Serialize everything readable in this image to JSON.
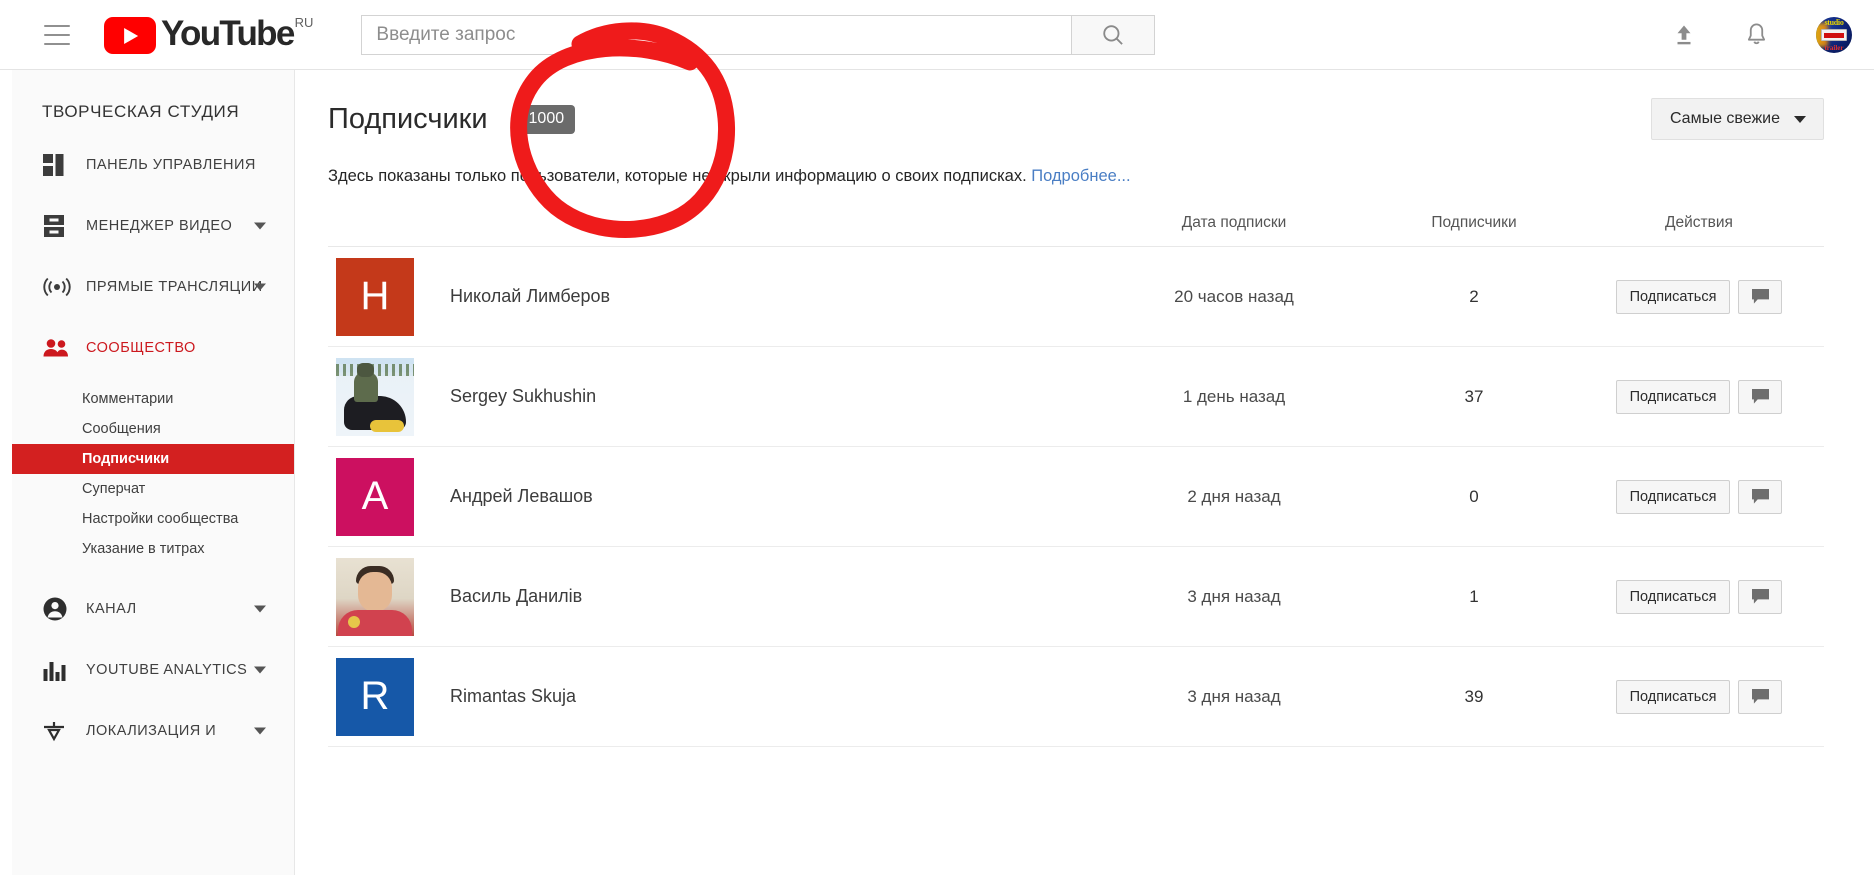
{
  "masthead": {
    "menu_icon": "hamburger-icon",
    "logo_text": "YouTube",
    "logo_country": "RU",
    "search_placeholder": "Введите запрос",
    "search_value": "",
    "search_icon": "search-icon",
    "upload_icon": "upload-icon",
    "notifications_icon": "bell-icon",
    "avatar_icon": "account-avatar",
    "avatar_top_text": "studio",
    "avatar_bottom_text": "trailer"
  },
  "sidebar": {
    "title": "ТВОРЧЕСКАЯ СТУДИЯ",
    "items": [
      {
        "label": "ПАНЕЛЬ УПРАВЛЕНИЯ",
        "icon": "dashboard-icon",
        "expandable": false,
        "active": false
      },
      {
        "label": "МЕНЕДЖЕР ВИДЕО",
        "icon": "video-manager-icon",
        "expandable": true,
        "active": false
      },
      {
        "label": "ПРЯМЫЕ ТРАНСЛЯЦИИ",
        "icon": "live-broadcast-icon",
        "expandable": true,
        "active": false
      },
      {
        "label": "СООБЩЕСТВО",
        "icon": "community-people-icon",
        "expandable": false,
        "active": true
      },
      {
        "label": "КАНАЛ",
        "icon": "channel-person-icon",
        "expandable": true,
        "active": false
      },
      {
        "label": "YOUTUBE ANALYTICS",
        "icon": "analytics-bars-icon",
        "expandable": true,
        "active": false
      },
      {
        "label": "ЛОКАЛИЗАЦИЯ И",
        "icon": "translate-icon",
        "expandable": true,
        "active": false
      }
    ],
    "sub_items": [
      {
        "label": "Комментарии",
        "selected": false
      },
      {
        "label": "Сообщения",
        "selected": false
      },
      {
        "label": "Подписчики",
        "selected": true
      },
      {
        "label": "Суперчат",
        "selected": false
      },
      {
        "label": "Настройки сообщества",
        "selected": false
      },
      {
        "label": "Указание в титрах",
        "selected": false
      }
    ]
  },
  "main": {
    "title": "Подписчики",
    "count_badge": "1000",
    "sort_label": "Самые свежие",
    "sort_caret_icon": "chevron-down-icon",
    "description_text": "Здесь показаны только пользователи, которые не скрыли информацию о своих подписках. ",
    "description_link": "Подробнее...",
    "columns": {
      "user": "",
      "date": "Дата подписки",
      "subscribers": "Подписчики",
      "actions": "Действия"
    },
    "subscribe_label": "Подписаться",
    "message_icon": "message-bubble-icon",
    "rows": [
      {
        "name": "Николай Лимберов",
        "avatar_type": "letter",
        "avatar_letter": "Н",
        "avatar_color": "#c4391a",
        "date": "20 часов назад",
        "subscribers": "2"
      },
      {
        "name": "Sergey Sukhushin",
        "avatar_type": "photo-snow",
        "avatar_letter": "",
        "avatar_color": "#cfe3f2",
        "date": "1 день назад",
        "subscribers": "37"
      },
      {
        "name": "Андрей Левашов",
        "avatar_type": "letter",
        "avatar_letter": "А",
        "avatar_color": "#cc1060",
        "date": "2 дня назад",
        "subscribers": "0"
      },
      {
        "name": "Василь Данилів",
        "avatar_type": "photo-man",
        "avatar_letter": "",
        "avatar_color": "#ded6c5",
        "date": "3 дня назад",
        "subscribers": "1"
      },
      {
        "name": "Rimantas Skuja",
        "avatar_type": "letter",
        "avatar_letter": "R",
        "avatar_color": "#1658a8",
        "date": "3 дня назад",
        "subscribers": "39"
      }
    ]
  },
  "annotation": {
    "shape": "hand-drawn-red-ellipse",
    "color": "#ef1b1b"
  }
}
